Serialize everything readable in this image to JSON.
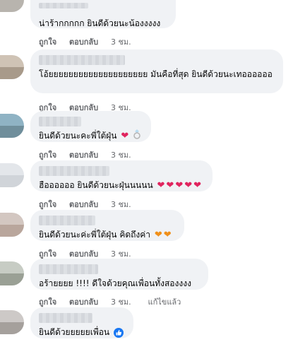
{
  "actions": {
    "like": "ถูกใจ",
    "reply": "ตอบกลับ"
  },
  "comments": [
    {
      "text": "น่าร้ากกกกก ยินดีด้วยนะน้องงงงง",
      "time": "3 ชม.",
      "edited": ""
    },
    {
      "text": "โอ้ยยยยยยยยยยยยยยยยยยยย มันคือที่สุด ยินดีด้วยนะเทออออออ",
      "time": "3 ชม.",
      "edited": ""
    },
    {
      "text": "ยินดีด้วยนะคะพี่ใต้ฝุ่น",
      "time": "3 ชม.",
      "edited": "",
      "emoji": [
        "red-heart",
        "ring"
      ]
    },
    {
      "text": "ฮืออออออ ยินดีด้วยนะฝุ่นนนนน",
      "time": "3 ชม.",
      "edited": "",
      "emoji": [
        "red-heart",
        "red-heart",
        "red-heart",
        "red-heart",
        "red-heart"
      ]
    },
    {
      "text": "ยินดีด้วยนะค่ะพี่ใต้ฝุ่น คิดถึงค่า",
      "time": "3 ชม.",
      "edited": "",
      "emoji": [
        "orange-heart",
        "orange-heart"
      ]
    },
    {
      "text": "อร้ายยยย !!!! ดีใจด้วยคุณเพื่อนทั้งสองงงง",
      "time": "3 ชม.",
      "edited": "แก้ไขแล้ว"
    },
    {
      "text": "ยินดีด้วยยยยยเพื่อน",
      "time": "",
      "edited": "",
      "emoji": [
        "like-badge"
      ]
    }
  ],
  "colors": {
    "bubble": "#f0f2f5",
    "heart_red": "#e0245e",
    "heart_orange": "#f0901a",
    "like_blue": "#1877f2"
  }
}
